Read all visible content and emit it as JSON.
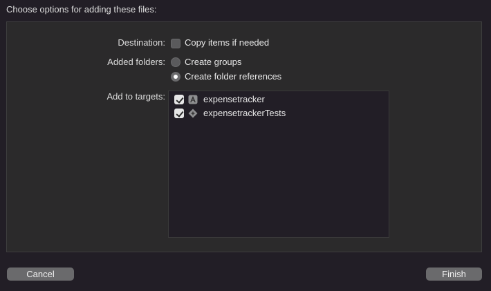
{
  "dialog": {
    "title": "Choose options for adding these files:"
  },
  "options": {
    "destination": {
      "label": "Destination:",
      "checkbox_label": "Copy items if needed",
      "checked": false
    },
    "added_folders": {
      "label": "Added folders:",
      "choices": [
        {
          "label": "Create groups",
          "selected": false
        },
        {
          "label": "Create folder references",
          "selected": true
        }
      ]
    },
    "targets": {
      "label": "Add to targets:",
      "items": [
        {
          "label": "expensetracker",
          "checked": true,
          "icon": "app-target-icon"
        },
        {
          "label": "expensetrackerTests",
          "checked": true,
          "icon": "test-target-icon"
        }
      ]
    }
  },
  "buttons": {
    "cancel": "Cancel",
    "finish": "Finish"
  },
  "colors": {
    "window_background": "#221e26",
    "panel_background": "#2b2a2b",
    "button_background": "#6a6a6c",
    "text": "#dcdcdc"
  }
}
